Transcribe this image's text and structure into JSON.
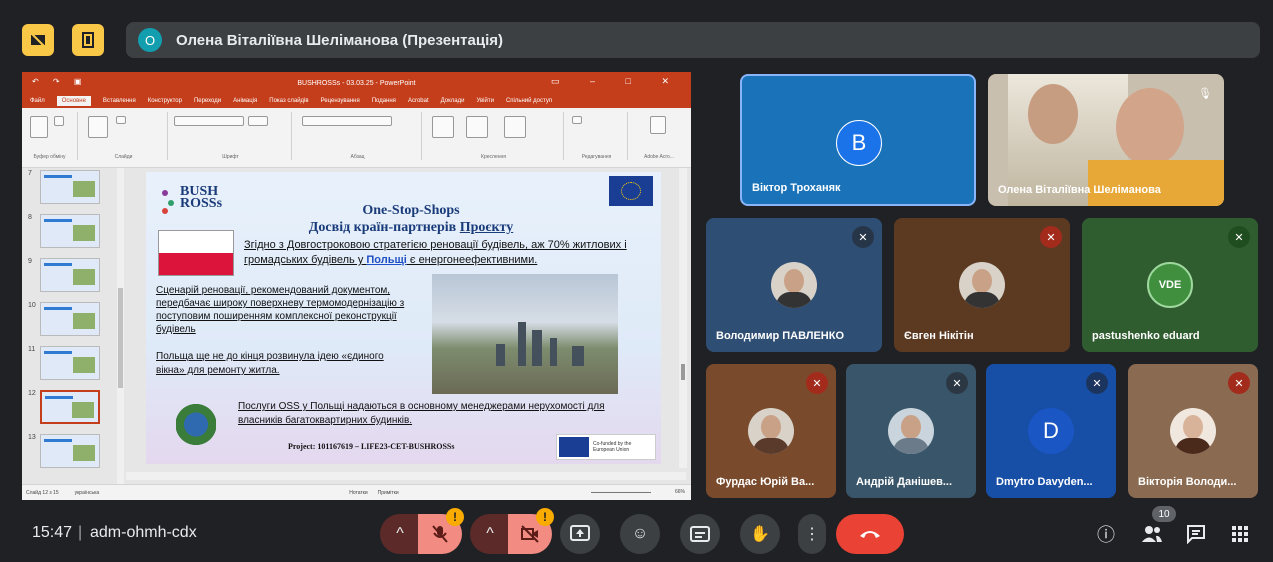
{
  "presenter": {
    "initial": "О",
    "label": "Олена Віталіївна Шеліманова (Презентація)"
  },
  "powerpoint": {
    "window_title": "BUSHROSSs - 03.03.25 - PowerPoint",
    "tabs": [
      "Файл",
      "Основне",
      "Вставлення",
      "Конструктор",
      "Переходи",
      "Анімація",
      "Показ слайдів",
      "Рецензування",
      "Подання",
      "Acrobat",
      "Доклади",
      "Увійти",
      "Спільний доступ"
    ],
    "active_tab": "Основне",
    "ribbon_groups": [
      "Буфер обміну",
      "Слайди",
      "Шрифт",
      "Абзац",
      "Креслення",
      "Редагування",
      "Adobe Acro..."
    ],
    "thumbnail_numbers": [
      "7",
      "8",
      "9",
      "10",
      "11",
      "12",
      "13"
    ],
    "selected_slide": "12",
    "status_left": "Слайд 12 з 15",
    "status_lang": "українська",
    "status_notes": "Нотатки",
    "status_comments": "Примітки",
    "zoom": "66%"
  },
  "slide": {
    "logo": "BUSH ROSSs",
    "title_line1": "One-Stop-Shops",
    "title_line2_a": "Досвід країн-партнерів ",
    "title_line2_b": "Проєкту",
    "text1_a": "Згідно з Довгостроковою стратегією реновації будівель, аж 70% житлових і громадських будівель у ",
    "text1_b": "Польщі",
    "text1_c": " є енергонеефективними.",
    "text2": "Сценарій реновації, рекомендований документом, передбачає широку поверхневу термомодернізацію з поступовим поширенням комплексної реконструкції будівель",
    "text3": "Польща ще не до кінця розвинула ідею «єдиного вікна» для ремонту житла.",
    "text4": "Послуги OSS у Польщі надаються в основному менеджерами нерухомості для власників багатоквартирних будинків.",
    "project": "Project: 101167619 – LIFE23-CET-BUSHROSSs",
    "cofunded": "Co-funded by the European Union"
  },
  "participants": [
    {
      "name": "Віктор Троханяк",
      "initial": "В"
    },
    {
      "name": "Олена Віталіївна Шеліманова"
    },
    {
      "name": "Володимир ПАВЛЕНКО"
    },
    {
      "name": "Євген Нікітін"
    },
    {
      "name": "pastushenko eduard"
    },
    {
      "name": "Фурдас Юрій Ва..."
    },
    {
      "name": "Андрій Данішев..."
    },
    {
      "name": "Dmytro Davyden...",
      "initial": "D"
    },
    {
      "name": "Вікторія Володи..."
    }
  ],
  "bottom": {
    "time": "15:47",
    "separator": "|",
    "meeting_code": "adm-ohmh-cdx",
    "warn": "!",
    "participant_count": "10"
  },
  "colors": {
    "background": "#202124",
    "tile": "#3c4043",
    "accent_yellow": "#f9c846",
    "end_call": "#ea4335",
    "ppt_brand": "#c43e1c"
  }
}
